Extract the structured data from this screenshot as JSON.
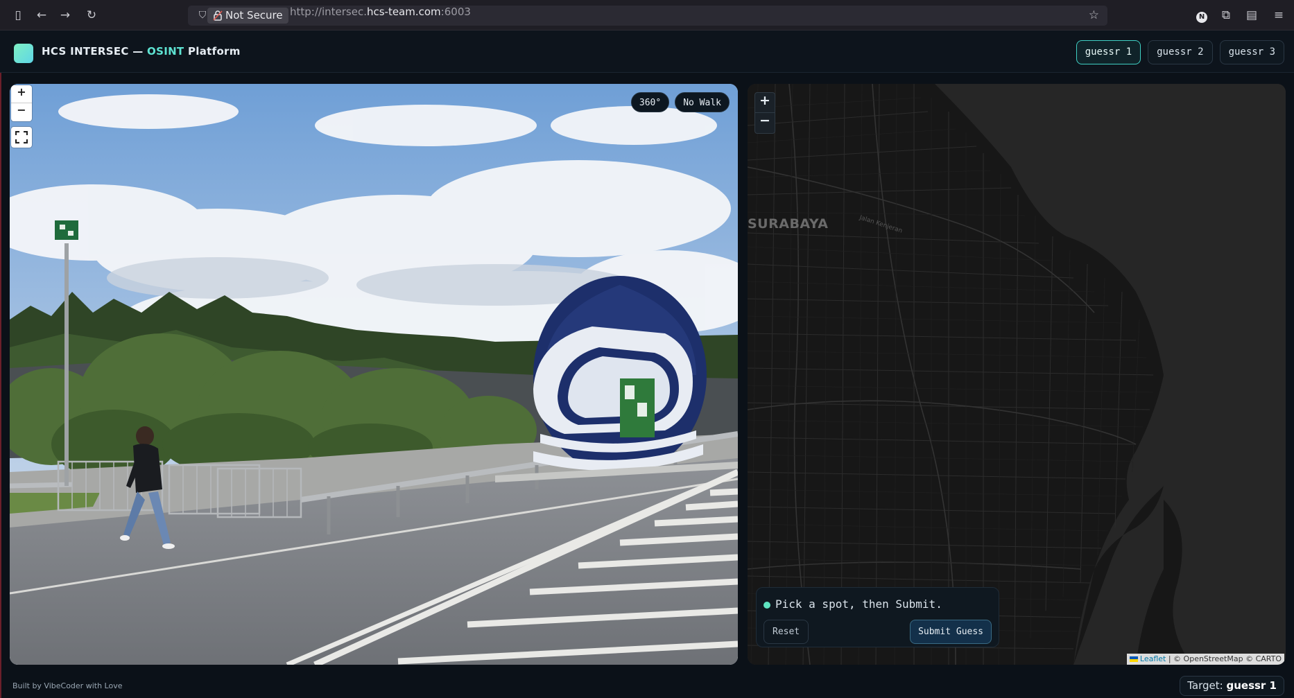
{
  "browser": {
    "security_label": "Not Secure",
    "url_prefix": "http://intersec.",
    "url_domain": "hcs-team.com",
    "url_suffix": ":6003"
  },
  "header": {
    "title_start": "HCS INTERSEC — ",
    "title_accent": "OSINT",
    "title_end": " Platform",
    "tabs": [
      {
        "label": "guessr 1",
        "active": true
      },
      {
        "label": "guessr 2",
        "active": false
      },
      {
        "label": "guessr 3",
        "active": false
      }
    ]
  },
  "street_view": {
    "zoom_in": "+",
    "zoom_out": "−",
    "pill_360": "360°",
    "pill_nowalk": "No Walk"
  },
  "map": {
    "zoom_in": "+",
    "zoom_out": "−",
    "city_label": "SURABAYA",
    "road_labels": [
      "Jalan Kenjeran"
    ],
    "attribution_leaflet": "Leaflet",
    "attribution_rest": " | © OpenStreetMap © CARTO"
  },
  "guess_panel": {
    "status_text": "Pick a spot, then Submit.",
    "reset_label": "Reset",
    "submit_label": "Submit Guess"
  },
  "footer": {
    "credit": "Built by VibeCoder with Love",
    "target_label": "Target: ",
    "target_value": "guessr 1"
  },
  "colors": {
    "accent": "#5ee3d2",
    "background": "#0b1118",
    "panel": "#0f1820"
  }
}
